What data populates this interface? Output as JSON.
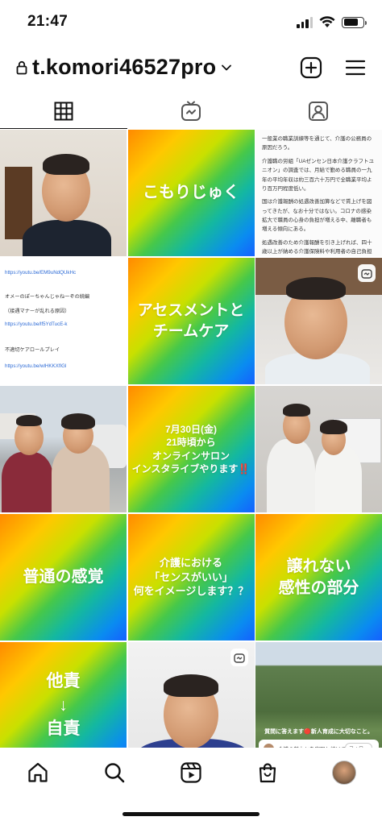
{
  "status_bar": {
    "time": "21:47"
  },
  "header": {
    "username": "t.komori46527pro"
  },
  "tabs": [
    {
      "name": "grid",
      "icon": "grid-icon",
      "active": true
    },
    {
      "name": "igtv",
      "icon": "igtv-icon",
      "active": false
    },
    {
      "name": "tagged",
      "icon": "tagged-person-icon",
      "active": false
    }
  ],
  "posts": {
    "p2": {
      "text": "こもりじゅく"
    },
    "p3": {
      "para1": "一般業の職業訓練等を通じて、介護の公務員の原因だろう。",
      "para2": "介護職の労組「UAゼンセン日本介護クラフトユニオン」の調査では、月給で勤める職員の一九年の平均年収は約三百六十万円で全職業平均より百万円程度低い。",
      "para3": "国は介護報酬の処遇改善加算などで賃上げを図ってきたが、なお十分ではない。コロナの感染拡大で職員の心身の負担が増える中、離職者も増える傾向にある。",
      "para4": "処遇改善のため介護報酬を引き上げれば、四十歳以上が納める介護保険料や利用者の自己負担増につながる。ある程度の負担増はやむを得ないとしても、介護報酬と"
    },
    "p4": {
      "link1": "https://youtu.be/EM9uNdQUkHc",
      "line1": "オメーのぽーちゃんじゃねーぞの続編",
      "line2": "（接遇マナーが乱れる原因）",
      "link2": "https://youtu.be/lf5YdTucE-k",
      "line3": "不適切ケアロールプレイ",
      "link3": "https://youtu.be/wlHKKXfIGl"
    },
    "p5": {
      "text": "アセスメントと\nチームケア"
    },
    "p8": {
      "text": "7月30日(金)\n21時頃から\nオンラインサロン\nインスタライブやります‼️"
    },
    "p10": {
      "text": "普通の感覚"
    },
    "p11": {
      "text": "介護における\n「センスがいい」\n何をイメージします？？"
    },
    "p12": {
      "text": "譲れない\n感性の部分"
    },
    "p13": {
      "text": "他責\n↓\n自責"
    },
    "p15": {
      "caption": "質問に答えます🔴新人育成に大切なこと。",
      "bar_text": "介護の魅力とを実現し続ける...",
      "follow": "フォロー"
    }
  },
  "bottom_nav": [
    {
      "name": "home",
      "icon": "home-icon"
    },
    {
      "name": "search",
      "icon": "search-icon"
    },
    {
      "name": "reels",
      "icon": "reels-icon"
    },
    {
      "name": "shop",
      "icon": "shop-bag-icon"
    },
    {
      "name": "profile",
      "icon": "profile-avatar"
    }
  ],
  "colors": {
    "link": "#2d6bd6",
    "text": "#111111"
  }
}
